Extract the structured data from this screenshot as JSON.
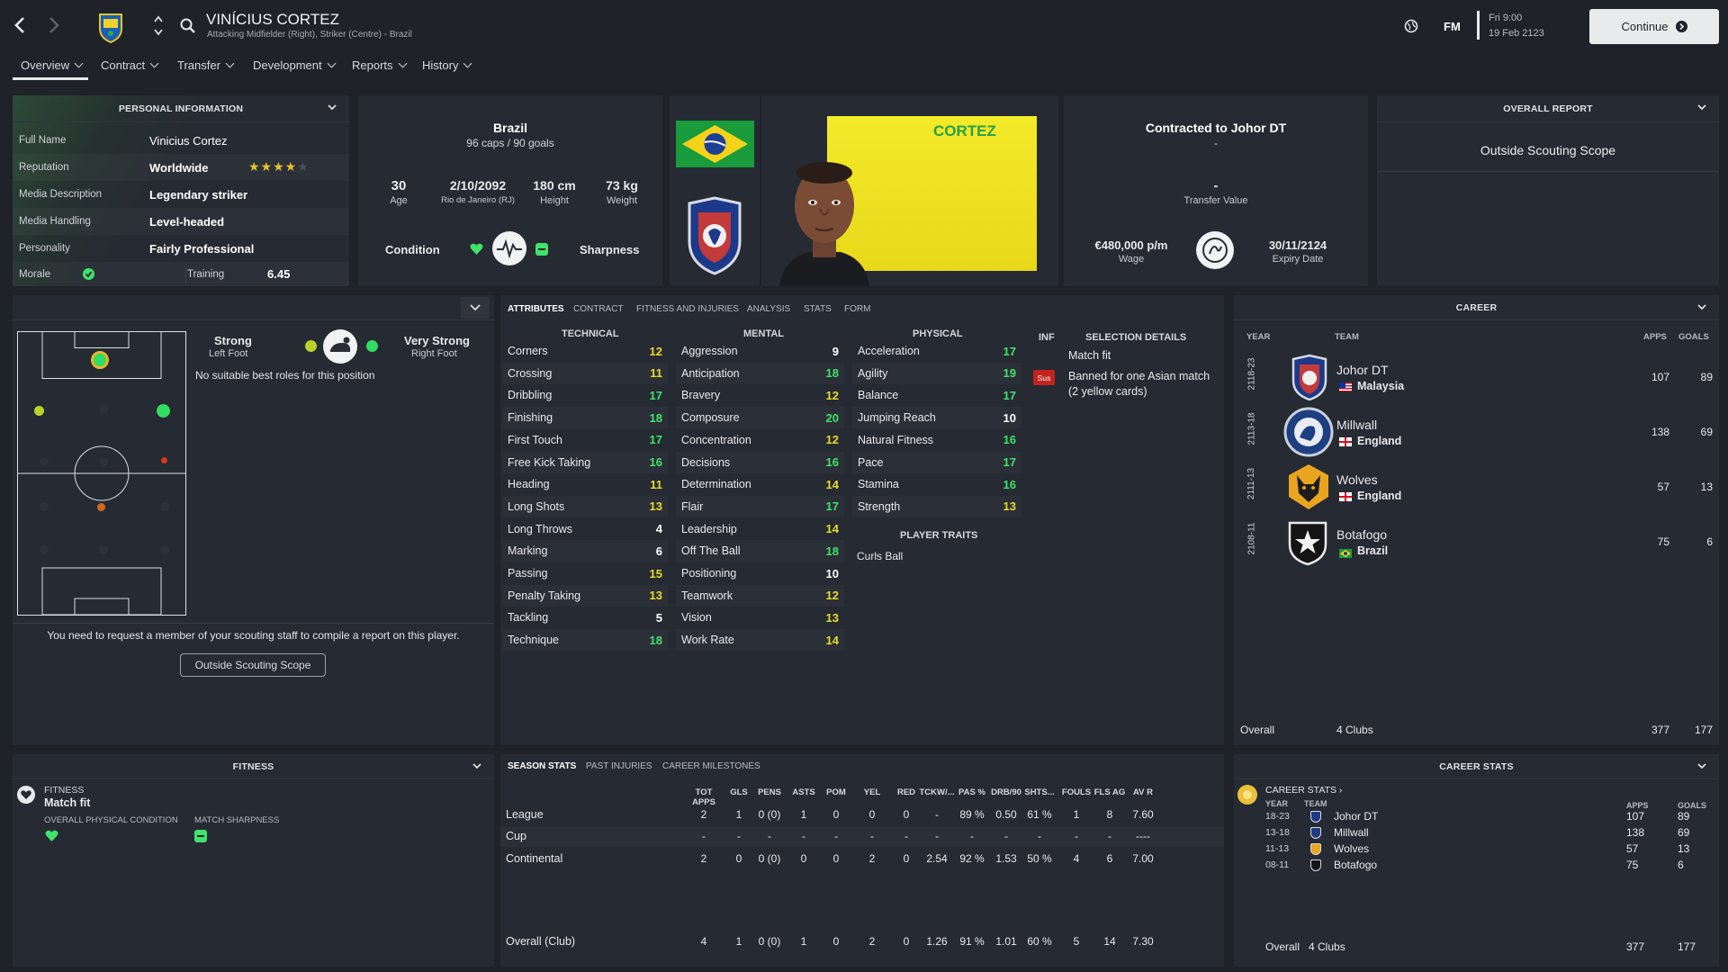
{
  "header": {
    "player_name": "VINÍCIUS CORTEZ",
    "positions": "Attacking Midfielder (Right), Striker (Centre) - Brazil",
    "fm_label": "FM",
    "date_line1": "Fri 9:00",
    "date_line2": "19 Feb 2123",
    "continue_label": "Continue"
  },
  "nav_tabs": [
    "Overview",
    "Contract",
    "Transfer",
    "Development",
    "Reports",
    "History"
  ],
  "personal": {
    "title": "PERSONAL INFORMATION",
    "rows": [
      {
        "label": "Full Name",
        "value": "Vinicius Cortez"
      },
      {
        "label": "Reputation",
        "value": "Worldwide"
      },
      {
        "label": "Media Description",
        "value": "Legendary striker"
      },
      {
        "label": "Media Handling",
        "value": "Level-headed"
      },
      {
        "label": "Personality",
        "value": "Fairly Professional"
      }
    ],
    "reputation_stars": 4,
    "morale_label": "Morale",
    "training_label": "Training",
    "training_value": "6.45"
  },
  "bio": {
    "nation": "Brazil",
    "caps": "96 caps / 90 goals",
    "age": "30",
    "age_label": "Age",
    "dob": "2/10/2092",
    "dob_place": "Rio de Janeiro (RJ)",
    "height": "180 cm",
    "height_label": "Height",
    "weight": "73 kg",
    "weight_label": "Weight",
    "condition_label": "Condition",
    "sharpness_label": "Sharpness",
    "shirt_name": "CORTEZ"
  },
  "contract": {
    "title": "Contracted to Johor DT",
    "dash1": "-",
    "dash2": "-",
    "transfer_value_label": "Transfer Value",
    "wage": "€480,000 p/m",
    "wage_label": "Wage",
    "expiry": "30/11/2124",
    "expiry_label": "Expiry Date"
  },
  "overall_report": {
    "title": "OVERALL REPORT",
    "text": "Outside Scouting Scope"
  },
  "position_panel": {
    "left_foot": "Strong",
    "left_foot_label": "Left Foot",
    "right_foot": "Very Strong",
    "right_foot_label": "Right Foot",
    "no_roles": "No suitable best roles for this position",
    "scout_msg": "You need to request a member of your scouting staff to compile a report on this player.",
    "scout_button": "Outside Scouting Scope"
  },
  "attr_tabs": [
    "ATTRIBUTES",
    "CONTRACT",
    "FITNESS AND INJURIES",
    "ANALYSIS",
    "STATS",
    "FORM"
  ],
  "technical": {
    "title": "TECHNICAL",
    "items": [
      {
        "n": "Corners",
        "v": "12"
      },
      {
        "n": "Crossing",
        "v": "11"
      },
      {
        "n": "Dribbling",
        "v": "17"
      },
      {
        "n": "Finishing",
        "v": "18"
      },
      {
        "n": "First Touch",
        "v": "17"
      },
      {
        "n": "Free Kick Taking",
        "v": "16"
      },
      {
        "n": "Heading",
        "v": "11"
      },
      {
        "n": "Long Shots",
        "v": "13"
      },
      {
        "n": "Long Throws",
        "v": "4"
      },
      {
        "n": "Marking",
        "v": "6"
      },
      {
        "n": "Passing",
        "v": "15"
      },
      {
        "n": "Penalty Taking",
        "v": "13"
      },
      {
        "n": "Tackling",
        "v": "5"
      },
      {
        "n": "Technique",
        "v": "18"
      }
    ]
  },
  "mental": {
    "title": "MENTAL",
    "items": [
      {
        "n": "Aggression",
        "v": "9"
      },
      {
        "n": "Anticipation",
        "v": "18"
      },
      {
        "n": "Bravery",
        "v": "12"
      },
      {
        "n": "Composure",
        "v": "20"
      },
      {
        "n": "Concentration",
        "v": "12"
      },
      {
        "n": "Decisions",
        "v": "16"
      },
      {
        "n": "Determination",
        "v": "14"
      },
      {
        "n": "Flair",
        "v": "17"
      },
      {
        "n": "Leadership",
        "v": "14"
      },
      {
        "n": "Off The Ball",
        "v": "18"
      },
      {
        "n": "Positioning",
        "v": "10"
      },
      {
        "n": "Teamwork",
        "v": "12"
      },
      {
        "n": "Vision",
        "v": "13"
      },
      {
        "n": "Work Rate",
        "v": "14"
      }
    ]
  },
  "physical": {
    "title": "PHYSICAL",
    "items": [
      {
        "n": "Acceleration",
        "v": "17"
      },
      {
        "n": "Agility",
        "v": "19"
      },
      {
        "n": "Balance",
        "v": "17"
      },
      {
        "n": "Jumping Reach",
        "v": "10"
      },
      {
        "n": "Natural Fitness",
        "v": "16"
      },
      {
        "n": "Pace",
        "v": "17"
      },
      {
        "n": "Stamina",
        "v": "16"
      },
      {
        "n": "Strength",
        "v": "13"
      }
    ],
    "traits_title": "PLAYER TRAITS",
    "traits": [
      "Curls Ball"
    ]
  },
  "selection": {
    "inf": "INF",
    "title": "SELECTION DETAILS",
    "match_fit": "Match fit",
    "sus_badge": "Sus",
    "ban_text": "Banned for one Asian match (2 yellow cards)"
  },
  "career": {
    "title": "CAREER",
    "cols": {
      "year": "YEAR",
      "team": "TEAM",
      "apps": "APPS",
      "goals": "GOALS"
    },
    "rows": [
      {
        "year": "2118-23",
        "team": "Johor DT",
        "country": "Malaysia",
        "apps": "107",
        "goals": "89"
      },
      {
        "year": "2113-18",
        "team": "Millwall",
        "country": "England",
        "apps": "138",
        "goals": "69"
      },
      {
        "year": "2111-13",
        "team": "Wolves",
        "country": "England",
        "apps": "57",
        "goals": "13"
      },
      {
        "year": "2108-11",
        "team": "Botafogo",
        "country": "Brazil",
        "apps": "75",
        "goals": "6"
      }
    ],
    "overall_label": "Overall",
    "overall_clubs": "4 Clubs",
    "overall_apps": "377",
    "overall_goals": "177"
  },
  "fitness": {
    "title": "FITNESS",
    "label": "FITNESS",
    "status": "Match fit",
    "overall_label": "OVERALL PHYSICAL CONDITION",
    "sharp_label": "MATCH SHARPNESS"
  },
  "season_tabs": [
    "SEASON STATS",
    "PAST INJURIES",
    "CAREER MILESTONES"
  ],
  "season_stats": {
    "cols": [
      "TOT APPS",
      "GLS",
      "PENS",
      "ASTS",
      "POM",
      "YEL",
      "RED",
      "TCKW/...",
      "PAS %",
      "DRB/90",
      "SHTS...",
      "FOULS",
      "FLS AG",
      "AV R"
    ],
    "rows": [
      {
        "name": "League",
        "vals": [
          "2",
          "1",
          "0 (0)",
          "1",
          "0",
          "0",
          "0",
          "-",
          "89 %",
          "0.50",
          "61 %",
          "1",
          "8",
          "7.60"
        ]
      },
      {
        "name": "Cup",
        "vals": [
          "-",
          "-",
          "-",
          "-",
          "-",
          "-",
          "-",
          "-",
          "-",
          "-",
          "-",
          "-",
          "-",
          "----"
        ]
      },
      {
        "name": "Continental",
        "vals": [
          "2",
          "0",
          "0 (0)",
          "0",
          "0",
          "2",
          "0",
          "2.54",
          "92 %",
          "1.53",
          "50 %",
          "4",
          "6",
          "7.00"
        ]
      }
    ],
    "overall": {
      "name": "Overall (Club)",
      "vals": [
        "4",
        "1",
        "0 (0)",
        "1",
        "0",
        "2",
        "0",
        "1.26",
        "91 %",
        "1.01",
        "60 %",
        "5",
        "14",
        "7.30"
      ]
    }
  },
  "career_stats": {
    "title": "CAREER STATS",
    "subtitle": "CAREER STATS",
    "cols": {
      "year": "YEAR",
      "team": "TEAM",
      "apps": "APPS",
      "goals": "GOALS"
    },
    "rows": [
      {
        "year": "18-23",
        "team": "Johor DT",
        "apps": "107",
        "goals": "89"
      },
      {
        "year": "13-18",
        "team": "Millwall",
        "apps": "138",
        "goals": "69"
      },
      {
        "year": "11-13",
        "team": "Wolves",
        "apps": "57",
        "goals": "13"
      },
      {
        "year": "08-11",
        "team": "Botafogo",
        "apps": "75",
        "goals": "6"
      }
    ],
    "overall_label": "Overall",
    "overall_clubs": "4 Clubs",
    "overall_apps": "377",
    "overall_goals": "177"
  },
  "colors": {
    "high": "#3fe36b",
    "mid": "#e4dc2a",
    "low": "#ffffff",
    "background": "#1f2229",
    "panel": "#262a33"
  }
}
